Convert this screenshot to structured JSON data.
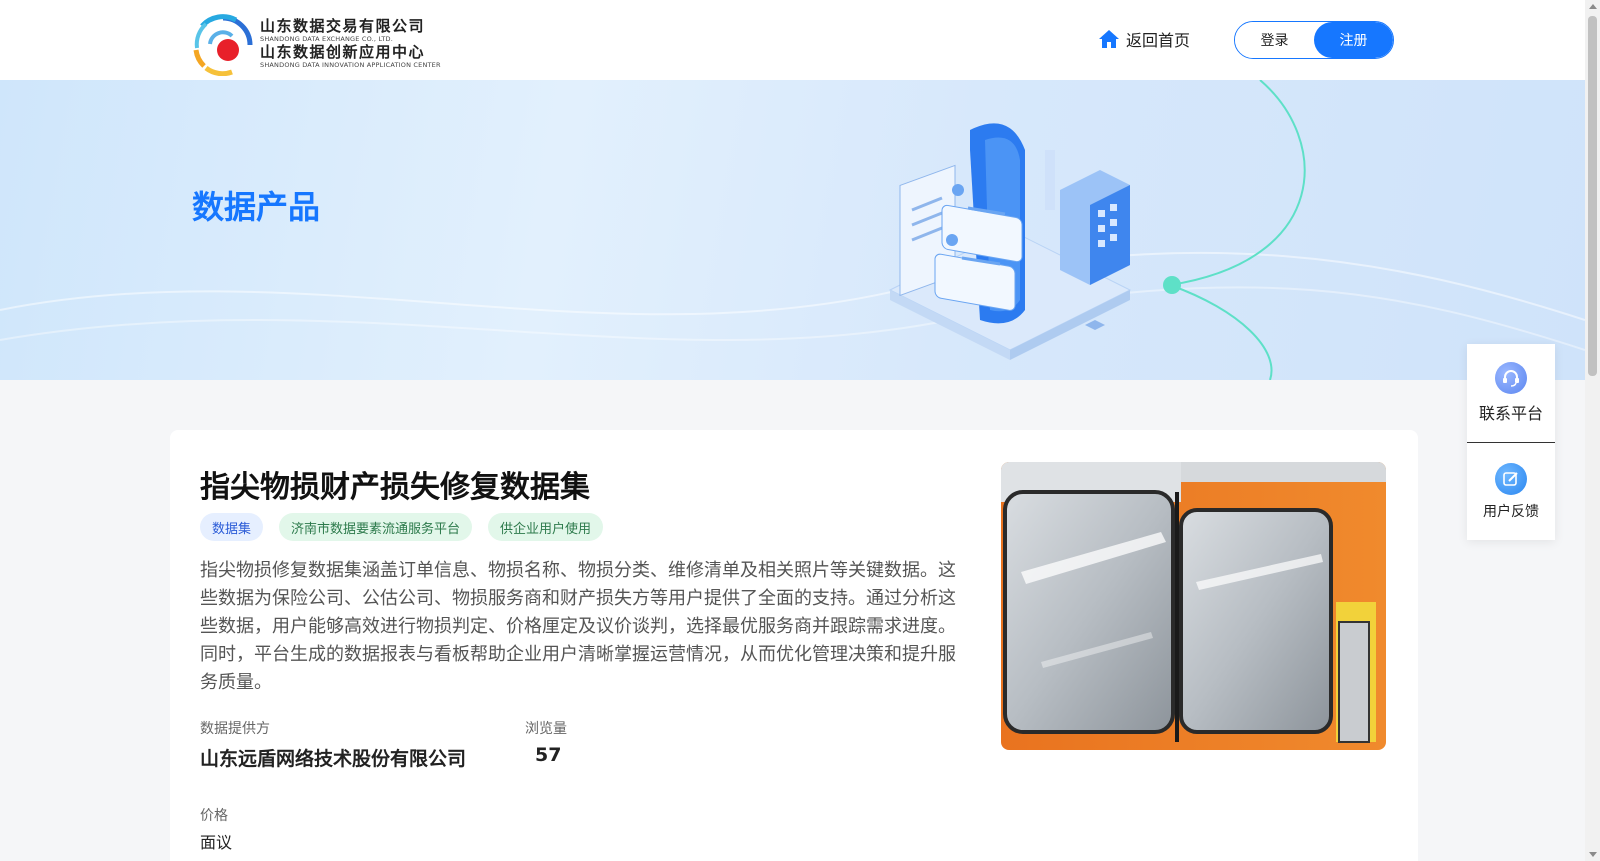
{
  "header": {
    "logo": {
      "line1_cn": "山东数据交易有限公司",
      "line1_en": "SHANDONG DATA EXCHANGE CO., LTD.",
      "line2_cn": "山东数据创新应用中心",
      "line2_en": "SHANDONG DATA INNOVATION APPLICATION CENTER"
    },
    "home_label": "返回首页",
    "login_label": "登录",
    "register_label": "注册"
  },
  "banner": {
    "title": "数据产品"
  },
  "side_float": {
    "contact_label": "联系平台",
    "feedback_label": "用户反馈"
  },
  "product": {
    "title": "指尖物损财产损失修复数据集",
    "tags": [
      "数据集",
      "济南市数据要素流通服务平台",
      "供企业用户使用"
    ],
    "description": "指尖物损修复数据集涵盖订单信息、物损名称、物损分类、维修清单及相关照片等关键数据。这些数据为保险公司、公估公司、物损服务商和财产损失方等用户提供了全面的支持。通过分析这些数据，用户能够高效进行物损判定、价格厘定及议价谈判，选择最优服务商并跟踪需求进度。同时，平台生成的数据报表与看板帮助企业用户清晰掌握运营情况，从而优化管理决策和提升服务质量。",
    "provider_label": "数据提供方",
    "provider_value": "山东远盾网络技术股份有限公司",
    "views_label": "浏览量",
    "views_value": "57",
    "price_label": "价格",
    "price_value": "面议"
  },
  "colors": {
    "primary": "#1677ff",
    "tag_blue_bg": "#e6efff",
    "tag_green_bg": "#e2f7ea"
  },
  "icons": [
    "home-icon",
    "headset-icon",
    "edit-icon"
  ]
}
